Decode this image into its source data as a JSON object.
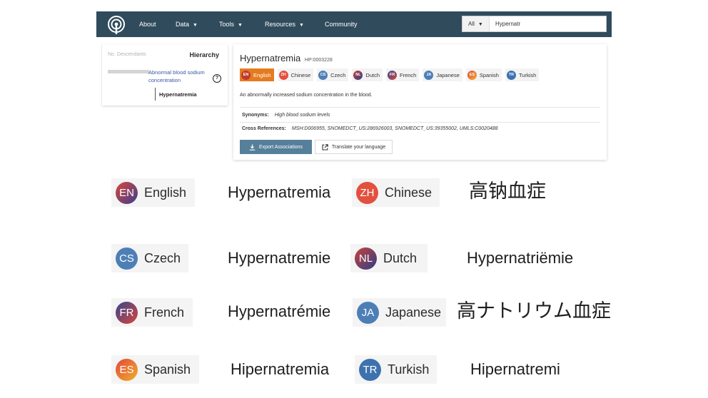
{
  "navbar": {
    "items": [
      {
        "label": "About",
        "dropdown": false
      },
      {
        "label": "Data",
        "dropdown": true
      },
      {
        "label": "Tools",
        "dropdown": true
      },
      {
        "label": "Resources",
        "dropdown": true
      },
      {
        "label": "Community",
        "dropdown": false
      }
    ],
    "search": {
      "category": "All",
      "value": "Hypernatr"
    }
  },
  "hierarchy": {
    "descendants_label": "No. Descendants",
    "title": "Hierarchy",
    "parent": "Abnormal blood sodium concentration",
    "child": "Hypernatremia",
    "help_icon": "question-circle-icon"
  },
  "term": {
    "name": "Hypernatremia",
    "id": "HP:0003228",
    "definition": "An abnormally increased sodium concentration in the blood.",
    "synonyms_label": "Synonyms:",
    "synonyms": "High blood sodium levels",
    "xrefs_label": "Cross References:",
    "xrefs": "MSH:D006955, SNOMEDCT_US:286926003, SNOMEDCT_US:39355002, UMLS:C0020488",
    "export_label": "Export Associations",
    "translate_label": "Translate your language",
    "export_icon": "download-icon",
    "translate_icon": "external-link-icon",
    "active_language": "EN"
  },
  "languages": [
    {
      "code": "EN",
      "name": "English",
      "translation": "Hypernatremia"
    },
    {
      "code": "ZH",
      "name": "Chinese",
      "translation": "高钠血症"
    },
    {
      "code": "CS",
      "name": "Czech",
      "translation": "Hypernatremie"
    },
    {
      "code": "NL",
      "name": "Dutch",
      "translation": "Hypernatriëmie"
    },
    {
      "code": "FR",
      "name": "French",
      "translation": "Hypernatrémie"
    },
    {
      "code": "JA",
      "name": "Japanese",
      "translation": "高ナトリウム血症"
    },
    {
      "code": "ES",
      "name": "Spanish",
      "translation": "Hipernatremia"
    },
    {
      "code": "TR",
      "name": "Turkish",
      "translation": "Hipernatremi"
    }
  ],
  "colors": {
    "navbar": "#2f4b5c",
    "active_language": "#e57b20",
    "export_button": "#557f9a",
    "link": "#3a56a6",
    "badge_EN": "linear-gradient(135deg,#d8463c,#3d3f8e)",
    "badge_ZH": "#e2513e",
    "badge_CS": "#4d7fb6",
    "badge_NL": "linear-gradient(135deg,#c8403a,#2f3f86)",
    "badge_FR": "linear-gradient(135deg,#33468e,#d9463c)",
    "badge_JA": "#4d7fb6",
    "badge_ES": "linear-gradient(135deg,#e2463a,#f0b02c)",
    "badge_TR": "#3e72ae"
  }
}
